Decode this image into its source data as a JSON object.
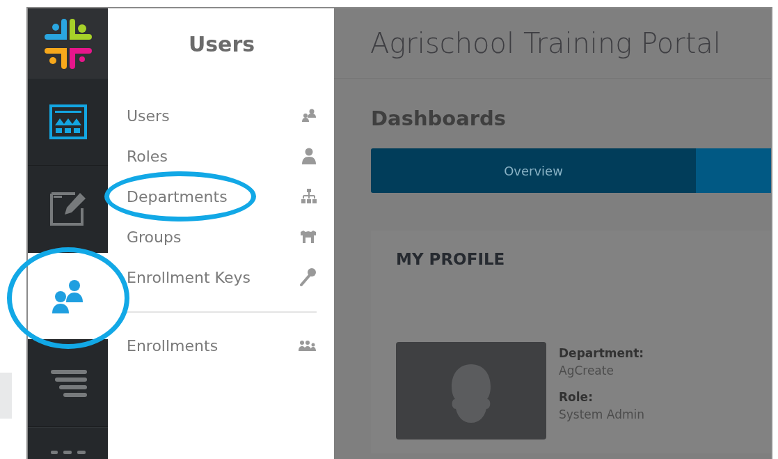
{
  "rail": {
    "items": [
      {
        "kind": "dashboard",
        "selected": false,
        "circled": false
      },
      {
        "kind": "edit",
        "selected": false,
        "circled": false
      },
      {
        "kind": "users",
        "selected": true,
        "circled": true
      },
      {
        "kind": "list",
        "selected": false,
        "circled": false
      },
      {
        "kind": "more",
        "selected": false,
        "circled": false
      }
    ]
  },
  "submenu": {
    "title": "Users",
    "groups": [
      [
        {
          "label": "Users",
          "kind": "users",
          "circled": false
        },
        {
          "label": "Roles",
          "kind": "role",
          "circled": false
        },
        {
          "label": "Departments",
          "kind": "tree",
          "circled": true
        },
        {
          "label": "Groups",
          "kind": "groups",
          "circled": false
        },
        {
          "label": "Enrollment Keys",
          "kind": "key",
          "circled": false
        }
      ],
      [
        {
          "label": "Enrollments",
          "kind": "enroll",
          "circled": false
        }
      ]
    ]
  },
  "header": {
    "title": "Agrischool Training Portal"
  },
  "page": {
    "title": "Dashboards"
  },
  "tabs": [
    {
      "label": "Overview",
      "selected": true
    },
    {
      "selected": false
    }
  ],
  "profile": {
    "title": "MY PROFILE",
    "fields": [
      {
        "label": "Department:",
        "value": "AgCreate"
      },
      {
        "label": "Role:",
        "value": "System Admin"
      }
    ]
  }
}
